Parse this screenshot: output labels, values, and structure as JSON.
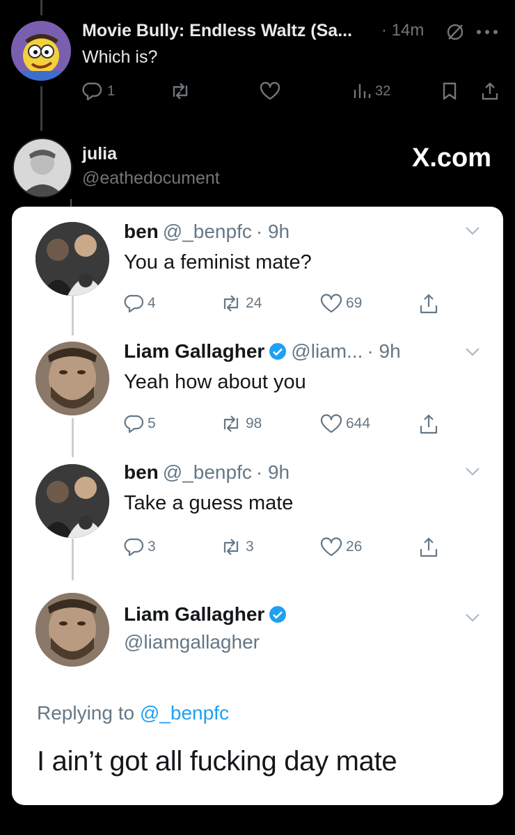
{
  "top_post": {
    "author": "Movie Bully: Endless Waltz (Sa...",
    "time": "· 14m",
    "text": "Which is?",
    "replies": "1",
    "views": "32"
  },
  "quoted_account": {
    "name": "julia",
    "handle": "@eathedocument",
    "watermark": "X.com"
  },
  "screenshot_tweets": [
    {
      "name": "ben",
      "handle": "@_benpfc",
      "time": "· 9h",
      "text": "You a feminist mate?",
      "replies": "4",
      "retweets": "24",
      "likes": "69"
    },
    {
      "name": "Liam Gallagher",
      "handle": "@liam...",
      "time": "· 9h",
      "text": "Yeah how about you",
      "replies": "5",
      "retweets": "98",
      "likes": "644"
    },
    {
      "name": "ben",
      "handle": "@_benpfc",
      "time": "· 9h",
      "text": "Take a guess mate",
      "replies": "3",
      "retweets": "3",
      "likes": "26"
    }
  ],
  "final_tweet": {
    "name": "Liam Gallagher",
    "handle": "@liamgallagher",
    "replying_prefix": "Replying to",
    "replying_to": "@_benpfc",
    "text": "I ain’t got all fucking day mate"
  },
  "colors": {
    "background": "#000000",
    "card": "#ffffff",
    "verified": "#1da1f2",
    "muted": "#71767b"
  },
  "icons": [
    "reply-icon",
    "retweet-icon",
    "like-icon",
    "views-icon",
    "bookmark-icon",
    "share-icon",
    "more-icon",
    "grok-icon",
    "verified-badge-icon",
    "chevron-down-icon"
  ]
}
